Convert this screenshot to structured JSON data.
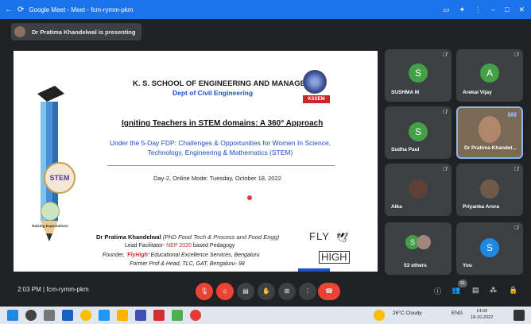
{
  "browser": {
    "title": "Google Meet - Meet - fcm-rymm-pkm",
    "back": "←",
    "reload": "⟳",
    "cast": "▭",
    "puzzle": "✦",
    "menu": "⋮",
    "minimize": "–",
    "maximize": "□",
    "close": "✕"
  },
  "presenting": {
    "text": "Dr Pratima Khandelwal is presenting"
  },
  "slide": {
    "institution": "K. S. SCHOOL OF ENGINEERING AND MANAGEMENT",
    "department": "Dept of Civil Engineering",
    "logo_text": "KSSEM",
    "headline": "Igniting Teachers in STEM domains: A 360° Approach",
    "subhead": "Under the 5-Day FDP: Challenges & Opportunities for Women In Science, Technology, Engineering & Mathematics (STEM)",
    "day": "Day-2, Online Mode: Tuesday, October 18, 2022",
    "stem_badge": "STEM",
    "raising": "Raising Expectations",
    "speaker_name": "Dr Pratima Khandelwal",
    "speaker_qual": " (PhD Food Tech & Process and Food Engg)",
    "lead_a": "Lead Facilitator- ",
    "lead_b": "NEP 2020",
    "lead_c": " based Pedagogy",
    "founder_a": "Founder, ",
    "founder_b": "'FlyHigh'",
    "founder_c": " Educational Excellence Services, Bengaluru",
    "former": "Former Prof & Head, TLC, GAT, Bengaluru- 98",
    "flyhigh_top": "FLY",
    "flyhigh_bottom": "HIGH"
  },
  "participants": [
    {
      "name": "SUSHMA M",
      "initial": "S",
      "color": "#43a047"
    },
    {
      "name": "Arekal Vijay",
      "initial": "A",
      "color": "#43a047"
    },
    {
      "name": "Sudha Paul",
      "initial": "S",
      "color": "#43a047"
    },
    {
      "name": "Dr Pratima Khandel..."
    },
    {
      "name": "Alka"
    },
    {
      "name": "Priyanka Arora"
    },
    {
      "name": "53 others",
      "initial": "S",
      "color": "#43a047"
    },
    {
      "name": "You",
      "initial": "S",
      "color": "#1e88e5"
    }
  ],
  "meeting": {
    "time": "2:03 PM",
    "sep": "|",
    "code": "fcm-rymm-pkm"
  },
  "people_count": "61",
  "system": {
    "weather": "26°C  Cloudy",
    "lang": "ENG",
    "time": "14:03",
    "date": "18-10-2022"
  }
}
